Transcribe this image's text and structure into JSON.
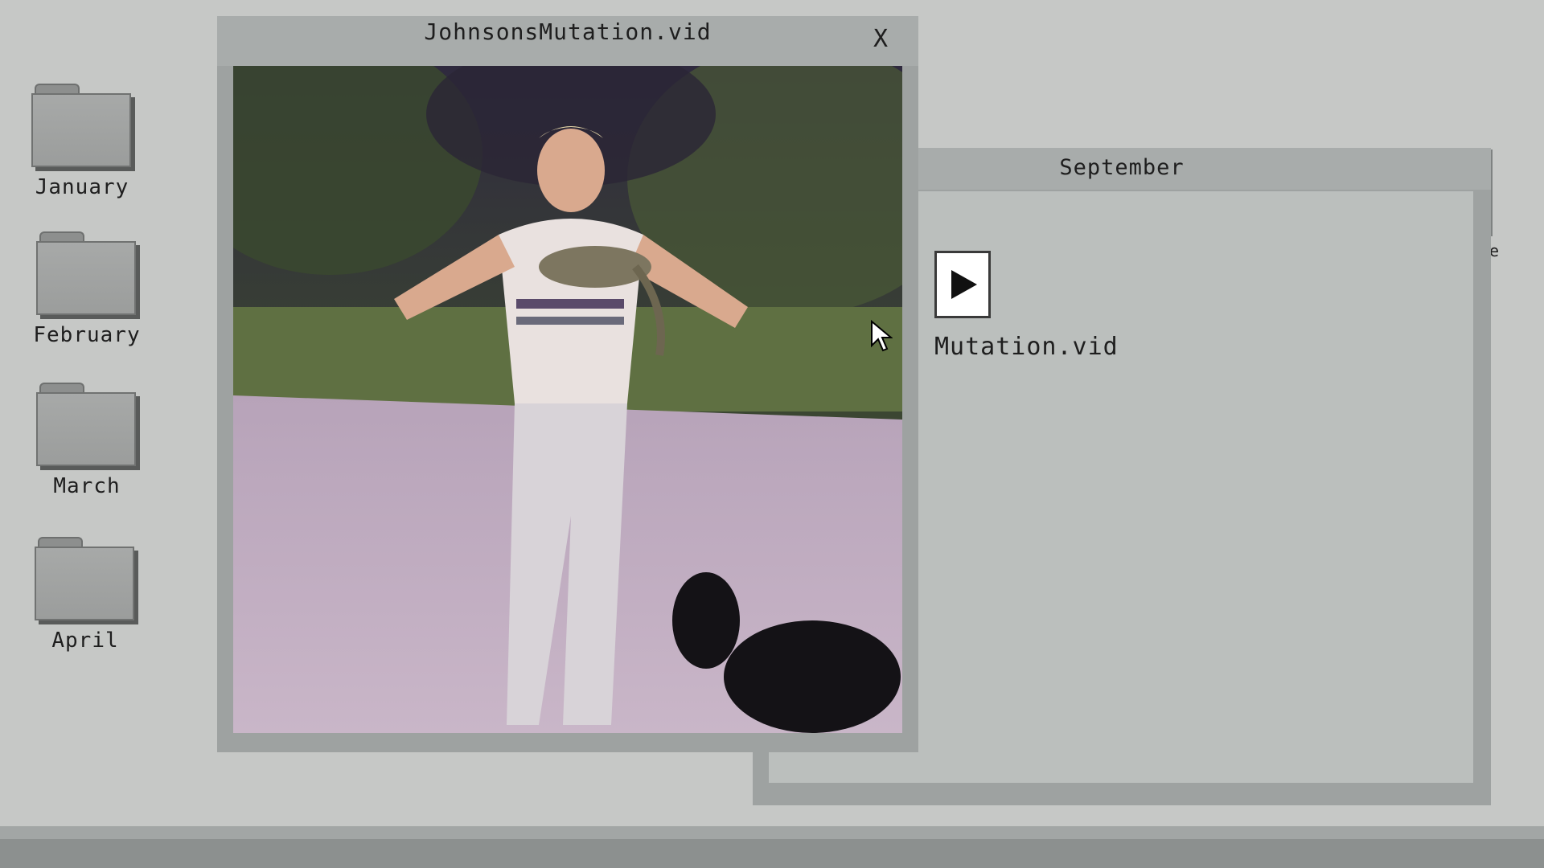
{
  "desktop": {
    "folders": [
      {
        "label": "January",
        "icon": "folder-icon"
      },
      {
        "label": "February",
        "icon": "folder-icon"
      },
      {
        "label": "March",
        "icon": "folder-icon"
      },
      {
        "label": "April",
        "icon": "folder-icon"
      }
    ],
    "partial_label": "e"
  },
  "video_window": {
    "title": "JohnsonsMutation.vid",
    "close_label": "X",
    "content": "video-frame"
  },
  "folder_window": {
    "title": "September",
    "files": [
      {
        "label": "Mutation.vid",
        "icon": "play-icon"
      }
    ]
  },
  "colors": {
    "desktop_bg": "#c6c8c6",
    "window_frame": "#9ea2a1",
    "window_body": "#bbbfbd",
    "text": "#1e1e1e"
  }
}
